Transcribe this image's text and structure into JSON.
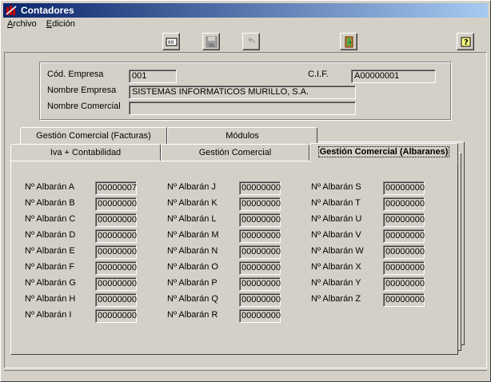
{
  "window": {
    "title": "Contadores"
  },
  "menu": [
    {
      "label": "Archivo",
      "accel": "A"
    },
    {
      "label": "Edición",
      "accel": "E"
    }
  ],
  "company": {
    "codigo_label": "Cód. Empresa",
    "codigo_value": "001",
    "cif_label": "C.I.F.",
    "cif_value": "A00000001",
    "nombre_label": "Nombre Empresa",
    "nombre_value": "SISTEMAS INFORMATICOS MURILLO, S.A.",
    "comercial_label": "Nombre Comercial",
    "comercial_value": ""
  },
  "tabs": {
    "gestion_facturas": "Gestión Comercial  (Facturas)",
    "modulos": "Módulos",
    "iva": "Iva + Contabilidad",
    "gestion": "Gestión Comercial",
    "albaranes": "Gestión Comercial  (Albaranes)"
  },
  "albaranes": {
    "col1": [
      {
        "label": "Nº Albarán  A",
        "value": "00000007"
      },
      {
        "label": "Nº Albarán  B",
        "value": "00000000"
      },
      {
        "label": "Nº Albarán  C",
        "value": "00000000"
      },
      {
        "label": "Nº Albarán  D",
        "value": "00000000"
      },
      {
        "label": "Nº Albarán  E",
        "value": "00000000"
      },
      {
        "label": "Nº Albarán  F",
        "value": "00000000"
      },
      {
        "label": "Nº Albarán  G",
        "value": "00000000"
      },
      {
        "label": "Nº Albarán  H",
        "value": "00000000"
      },
      {
        "label": "Nº Albarán  I",
        "value": "00000000"
      }
    ],
    "col2": [
      {
        "label": "Nº Albarán  J",
        "value": "00000000"
      },
      {
        "label": "Nº Albarán  K",
        "value": "00000000"
      },
      {
        "label": "Nº Albarán  L",
        "value": "00000000"
      },
      {
        "label": "Nº Albarán  M",
        "value": "00000000"
      },
      {
        "label": "Nº Albarán  N",
        "value": "00000000"
      },
      {
        "label": "Nº Albarán  O",
        "value": "00000000"
      },
      {
        "label": "Nº Albarán  P",
        "value": "00000000"
      },
      {
        "label": "Nº Albarán  Q",
        "value": "00000000"
      },
      {
        "label": "Nº Albarán  R",
        "value": "00000000"
      }
    ],
    "col3": [
      {
        "label": "Nº Albarán  S",
        "value": "00000000"
      },
      {
        "label": "Nº Albarán  T",
        "value": "00000000"
      },
      {
        "label": "Nº Albarán  U",
        "value": "00000000"
      },
      {
        "label": "Nº Albarán  V",
        "value": "00000000"
      },
      {
        "label": "Nº Albarán  W",
        "value": "00000000"
      },
      {
        "label": "Nº Albarán  X",
        "value": "00000000"
      },
      {
        "label": "Nº Albarán  Y",
        "value": "00000000"
      },
      {
        "label": "Nº Albarán  Z",
        "value": "00000000"
      }
    ]
  },
  "toolbar": [
    "calculator-icon",
    "save-icon",
    "undo-icon",
    "exit-door-icon",
    "help-icon"
  ]
}
